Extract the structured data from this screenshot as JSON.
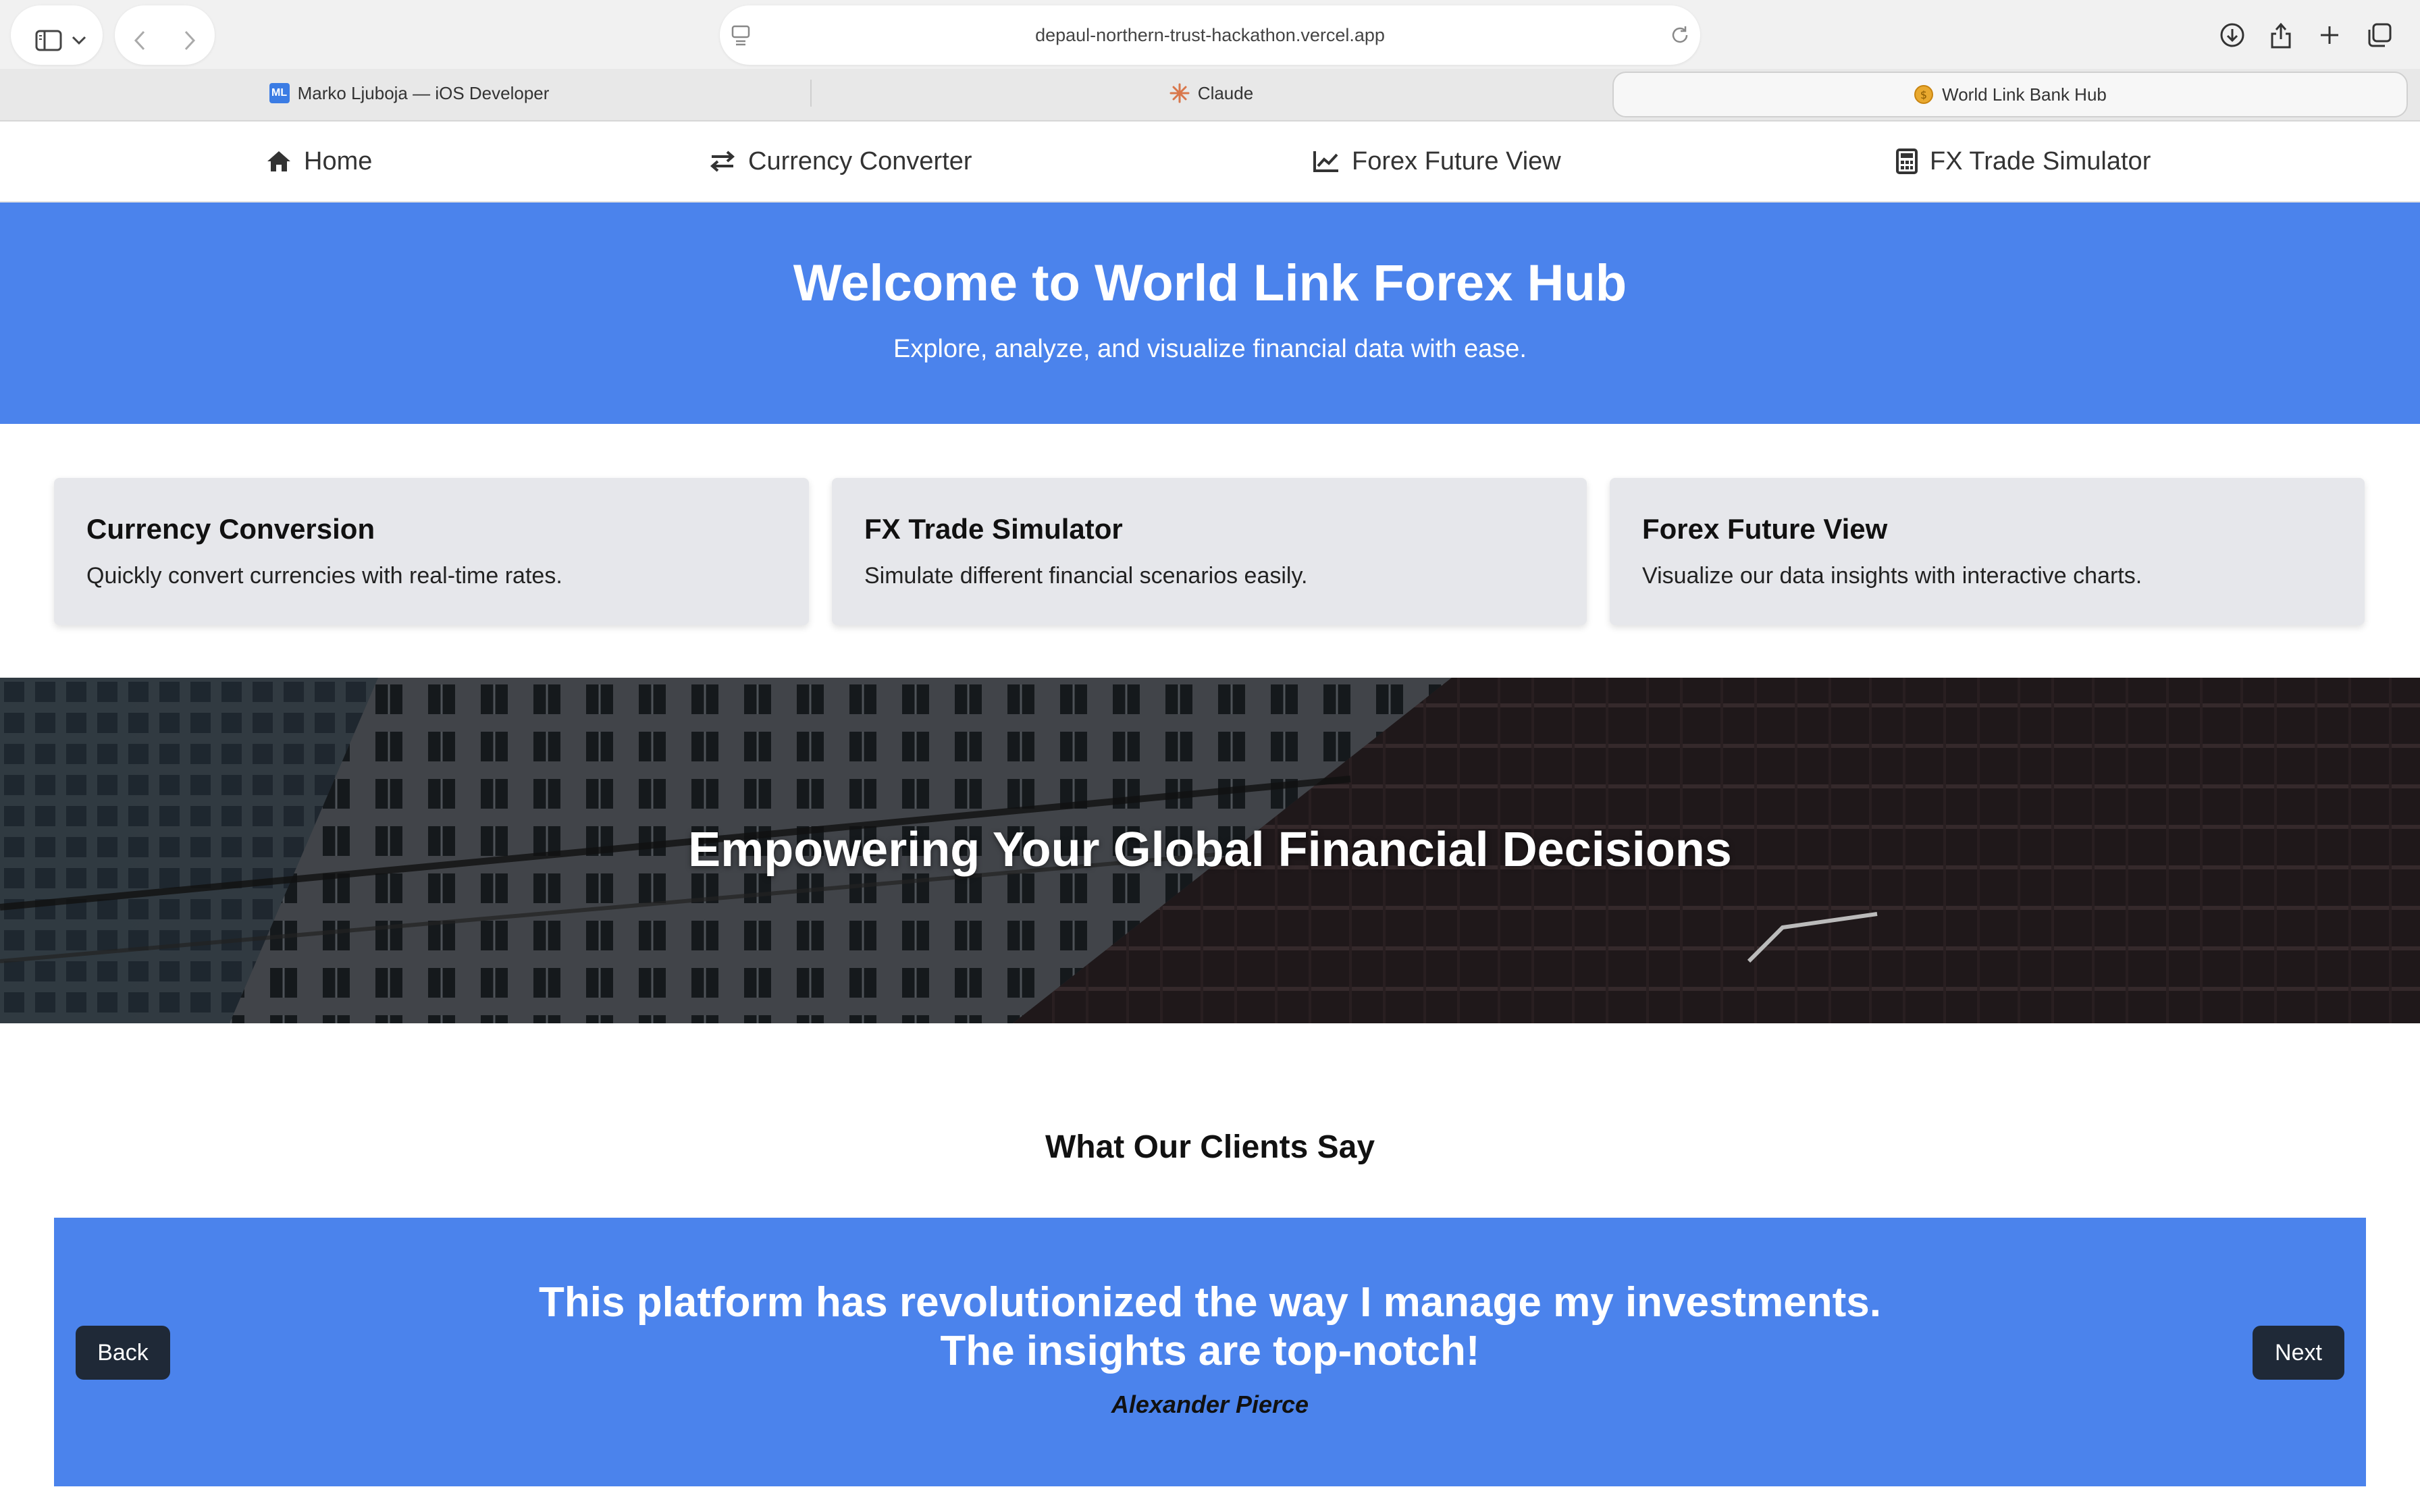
{
  "browser": {
    "url": "depaul-northern-trust-hackathon.vercel.app",
    "tabs": [
      {
        "label": "Marko Ljuboja — iOS Developer",
        "favicon": "ML",
        "active": false
      },
      {
        "label": "Claude",
        "favicon": "claude-sparkle-icon",
        "active": false
      },
      {
        "label": "World Link Bank Hub",
        "favicon": "coin-icon",
        "active": true
      }
    ]
  },
  "nav": {
    "items": [
      {
        "label": "Home",
        "icon": "home-icon"
      },
      {
        "label": "Currency Converter",
        "icon": "exchange-arrows-icon"
      },
      {
        "label": "Forex Future View",
        "icon": "line-chart-icon"
      },
      {
        "label": "FX Trade Simulator",
        "icon": "calculator-icon"
      }
    ]
  },
  "hero": {
    "title": "Welcome to World Link Forex Hub",
    "subtitle": "Explore, analyze, and visualize financial data with ease."
  },
  "features": [
    {
      "title": "Currency Conversion",
      "description": "Quickly convert currencies with real-time rates."
    },
    {
      "title": "FX Trade Simulator",
      "description": "Simulate different financial scenarios easily."
    },
    {
      "title": "Forex Future View",
      "description": "Visualize our data insights with interactive charts."
    }
  ],
  "banner": {
    "title": "Empowering Your Global Financial Decisions"
  },
  "testimonials": {
    "heading": "What Our Clients Say",
    "quote_line1": "This platform has revolutionized the way I manage my investments.",
    "quote_line2": "The insights are top-notch!",
    "author": "Alexander Pierce",
    "back_label": "Back",
    "next_label": "Next"
  },
  "colors": {
    "accent": "#4b83ec",
    "button_dark": "#1f2937",
    "card_bg": "#e6e7eb"
  }
}
